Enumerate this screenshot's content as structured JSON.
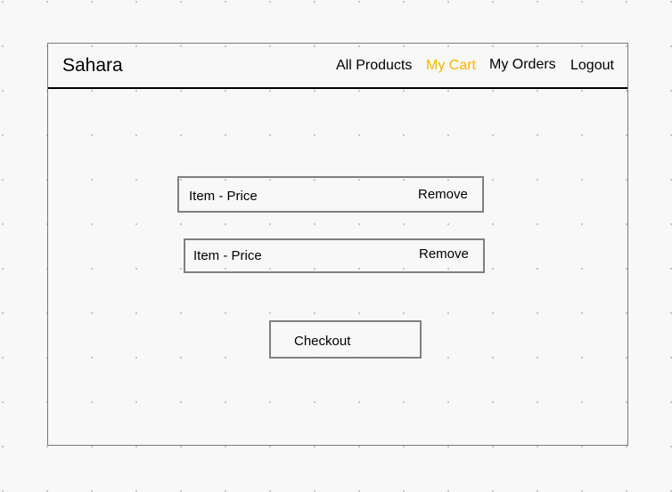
{
  "navbar": {
    "brand": "Sahara",
    "links": [
      {
        "label": "All Products"
      },
      {
        "label": "My Cart",
        "active": true
      },
      {
        "label": "My Orders"
      },
      {
        "label": "Logout"
      }
    ],
    "active_color": "#f5b400"
  },
  "cart": {
    "items": [
      {
        "label": "Item - Price",
        "action": "Remove"
      },
      {
        "label": "Item - Price",
        "action": "Remove"
      }
    ],
    "checkout_label": "Checkout"
  }
}
